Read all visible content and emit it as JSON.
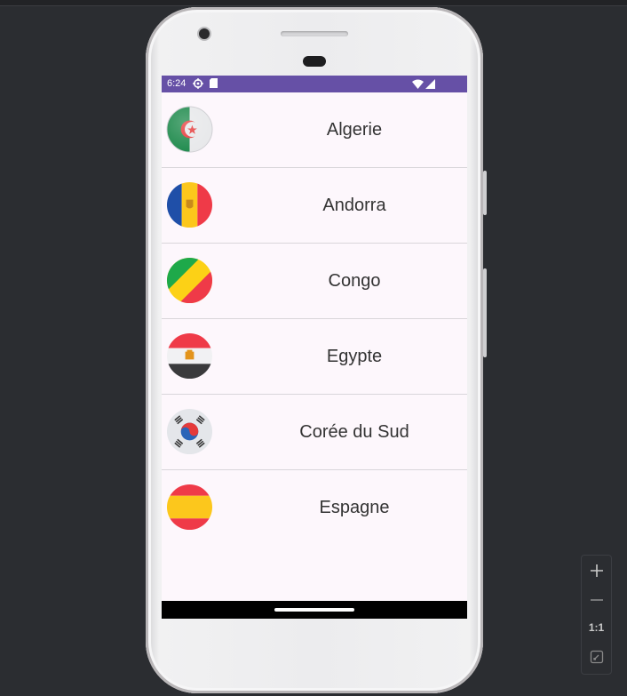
{
  "status_bar": {
    "time": "6:24"
  },
  "countries": [
    {
      "name": "Algerie",
      "flag": "algeria-flag-icon"
    },
    {
      "name": "Andorra",
      "flag": "andorra-flag-icon"
    },
    {
      "name": "Congo",
      "flag": "congo-flag-icon"
    },
    {
      "name": "Egypte",
      "flag": "egypt-flag-icon"
    },
    {
      "name": "Corée du Sud",
      "flag": "south-korea-flag-icon"
    },
    {
      "name": "Espagne",
      "flag": "spain-flag-icon"
    }
  ],
  "zoom_controls": {
    "reset_label": "1:1"
  },
  "colors": {
    "status_bar": "#6650a6",
    "screen_bg": "#fdf7fc"
  }
}
